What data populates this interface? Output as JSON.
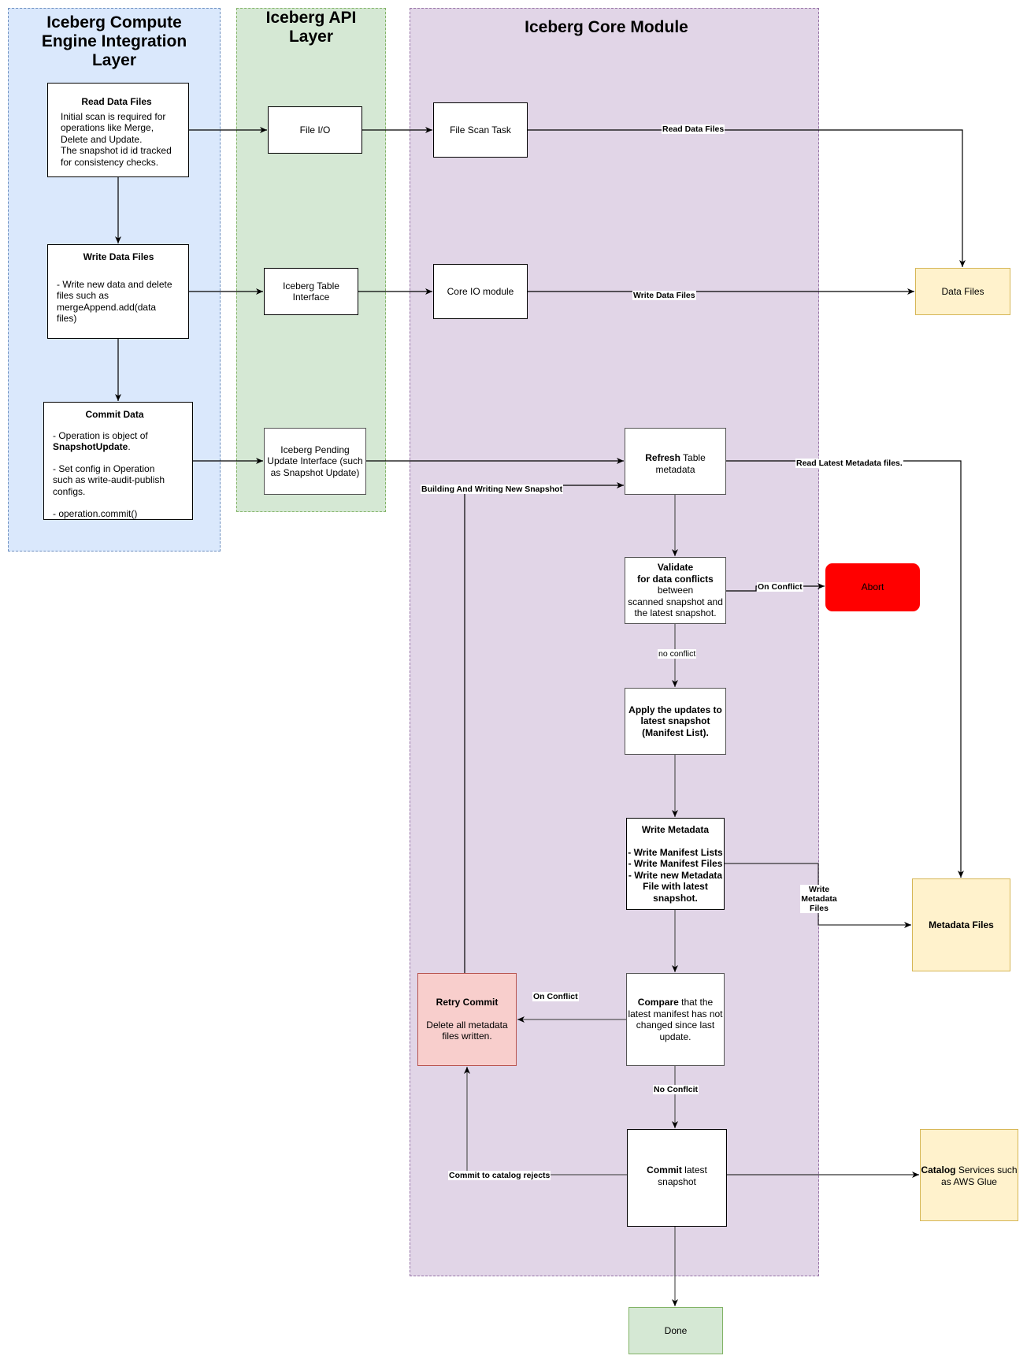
{
  "lanes": {
    "compute": {
      "title": "Iceberg Compute Engine Integration Layer",
      "color": "#dae8fc"
    },
    "api": {
      "title": "Iceberg API Layer",
      "color": "#d5e8d4"
    },
    "core": {
      "title": "Iceberg Core Module",
      "color": "#e1d5e7"
    }
  },
  "nodes": {
    "read_data_files": {
      "title": "Read Data Files",
      "lines": [
        "Initial scan is required for",
        "operations like Merge,",
        "Delete and Update.",
        "The snapshot id id tracked",
        "for consistency checks."
      ]
    },
    "write_data_files": {
      "title": "Write Data Files",
      "lines": [
        "- Write new data and delete",
        "files such as",
        "mergeAppend.add(data",
        "files)"
      ]
    },
    "commit_data": {
      "title": "Commit Data",
      "op_prefix": "- Operation is object of",
      "op_class": "SnapshotUpdate",
      "op_suffix": ".",
      "config_lines": [
        "- Set config in Operation",
        "such as write-audit-publish",
        "configs."
      ],
      "commit_call": "- operation.commit()"
    },
    "file_io": {
      "label": "File I/O"
    },
    "table_interface": {
      "line1": "Iceberg Table",
      "line2": "Interface"
    },
    "pending_update": {
      "line1": "Iceberg Pending",
      "line2": "Update Interface (such",
      "line3": "as Snapshot Update)"
    },
    "file_scan_task": {
      "label": "File Scan Task"
    },
    "core_io": {
      "label": "Core IO module"
    },
    "refresh": {
      "bold": "Refresh",
      "rest": " Table",
      "line2": "metadata"
    },
    "validate": {
      "bold1": "Validate",
      "bold2": "for data conflicts",
      "line3": "between",
      "line4": "scanned snapshot and",
      "line5": "the latest snapshot."
    },
    "apply": {
      "line1": "Apply the updates to",
      "line2": "latest snapshot",
      "line3": "(Manifest List)."
    },
    "write_metadata": {
      "title": "Write Metadata",
      "lines": [
        "- Write Manifest Lists",
        "- Write Manifest Files",
        "- Write new Metadata",
        "File with latest",
        "snapshot."
      ]
    },
    "compare": {
      "bold": "Compare",
      "rest": " that the",
      "line2": "latest manifest has not",
      "line3": "changed since last",
      "line4": "update."
    },
    "commit_latest": {
      "bold": "Commit",
      "rest": " latest",
      "line2": "snapshot"
    },
    "retry_commit": {
      "title": "Retry Commit",
      "line1": "Delete all metadata",
      "line2": "files written."
    },
    "abort": {
      "label": "Abort",
      "color": "#ff0000"
    },
    "done": {
      "label": "Done"
    },
    "data_files": {
      "label": "Data Files"
    },
    "metadata_files": {
      "label": "Metadata Files"
    },
    "catalog": {
      "bold": "Catalog",
      "rest": " Services such",
      "line2": "as AWS Glue"
    }
  },
  "edge_labels": {
    "read_data_files": "Read Data Files",
    "write_data_files": "Write Data Files",
    "read_latest_metadata": "Read Latest Metadata files.",
    "building_snapshot": "Building And Writing New Snapshot",
    "on_conflict_abort": "On Conflict",
    "no_conflict": "no conflict",
    "write_metadata_files": "Write Metadata Files",
    "on_conflict_retry": "On Conflict",
    "no_conflict_commit": "No Conflcit",
    "catalog_rejects": "Commit to catalog rejects"
  }
}
